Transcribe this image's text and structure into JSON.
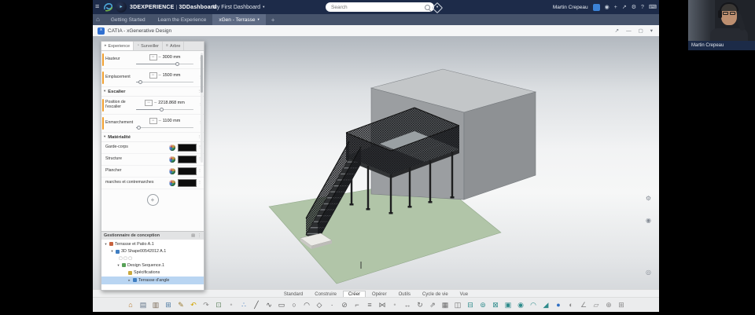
{
  "topbar": {
    "brand": "3DEXPERIENCE",
    "sep": "|",
    "product": "3DDashboard",
    "dashboard": "My First Dashboard",
    "search_placeholder": "Search",
    "user": "Martin Crepeau",
    "accent_color": "#3b82d6",
    "icons": {
      "menu": "≡",
      "compass": "◉",
      "add": "+",
      "share": "↗",
      "settings": "⚙",
      "help": "?",
      "keyboard": "⌨",
      "caret": "▾",
      "play": "▸"
    }
  },
  "tabbar": {
    "tabs": [
      "Getting Started",
      "Learn the Experience"
    ],
    "active": "xGen - Terrasse",
    "caret": "▾",
    "add": "+",
    "home": "⌂"
  },
  "appbar": {
    "title": "CATIA - xGenerative Design",
    "app_initial": "x",
    "icons": {
      "share_user": "↗",
      "minimize": "—",
      "fullscreen": "▢",
      "collapse": "▾"
    }
  },
  "panel": {
    "tabs": [
      {
        "label": "Experience",
        "icon": "▸",
        "bg": "#ffffff"
      },
      {
        "label": "Surveiller",
        "icon": "◔"
      },
      {
        "label": "Arbre",
        "icon": "≡"
      }
    ],
    "dash": "–",
    "kebab": "⋮",
    "caret": "▾",
    "dimension_icon": "▭",
    "accent_color": "#f0a030",
    "params": [
      {
        "label": "Hauteur",
        "value": "3000 mm",
        "fill": "72%",
        "accent": "#f0a030"
      },
      {
        "label": "Emplacement",
        "value": "1500 mm",
        "fill": "8%",
        "accent": "#f0a030"
      }
    ],
    "escalier": {
      "title": "Escalier",
      "params": [
        {
          "label": "Position de l'escalier",
          "value": "2218.868 mm",
          "fill": "45%",
          "accent": "#f0a030"
        },
        {
          "label": "Enmarchement",
          "value": "1100 mm",
          "fill": "6%",
          "accent": "#f0a030"
        }
      ]
    },
    "materialite": {
      "title": "Matérialité",
      "rows": [
        {
          "label": "Garde-corps",
          "swatch": "#0d0d0d"
        },
        {
          "label": "Structure",
          "swatch": "#0d0d0d"
        },
        {
          "label": "Plancher",
          "swatch": "#0d0d0d"
        },
        {
          "label": "marches et contremarches",
          "swatch": "#0d0d0d"
        }
      ]
    },
    "add": "+"
  },
  "design_manager": {
    "title": "Gestionnaire de conception",
    "icons": {
      "list": "▤",
      "kebab": "⋮"
    },
    "chips": "▢ ▢ ▢",
    "tree_top": [
      {
        "label": "Terrasse et Patio A.1",
        "pad": "3px",
        "icon": "#c7623e",
        "expand": "▾"
      },
      {
        "label": "3D Shape00542012 A.1",
        "pad": "11px",
        "icon": "#3f7ec2",
        "expand": "▾"
      }
    ],
    "tree_bottom": [
      {
        "label": "Design Sequence.1",
        "pad": "19px",
        "icon": "#57a157",
        "expand": "▾"
      },
      {
        "label": "Spécifications",
        "pad": "27px",
        "icon": "#caa93f"
      },
      {
        "label": "Terrasse d'angle",
        "pad": "33px",
        "icon": "#3f7ec2",
        "expand": "▸",
        "bg": "#b9d5f2"
      }
    ]
  },
  "viewport": {
    "right_icons": [
      {
        "g": "⚙",
        "n": "settings-icon"
      },
      {
        "g": "◉",
        "n": "assistant-icon"
      },
      {
        "g": "◎",
        "n": "view-cube-icon"
      }
    ]
  },
  "ribbon": {
    "tabs": [
      {
        "label": "Standard"
      },
      {
        "label": "Construire"
      },
      {
        "label": "Créer",
        "bg": "#ffffff",
        "bd": "#c8c9ca",
        "fg": "#222222"
      },
      {
        "label": "Opérer"
      },
      {
        "label": "Outils"
      },
      {
        "label": "Cycle de vie"
      },
      {
        "label": "Vue"
      }
    ]
  },
  "toolbar": {
    "icons": [
      {
        "n": "home-icon",
        "g": "⌂",
        "c": "#b5762a"
      },
      {
        "n": "data-panel-icon",
        "g": "▤",
        "c": "#5f7286"
      },
      {
        "n": "catalog-icon",
        "g": "▥",
        "c": "#7a6a55"
      },
      {
        "n": "window-icon",
        "g": "⊞",
        "c": "#4f7ba3"
      },
      {
        "n": "sketch-icon",
        "g": "✎",
        "c": "#9a7a2f"
      },
      {
        "n": "undo-icon",
        "g": "↶",
        "c": "#d2a400"
      },
      {
        "n": "redo-icon",
        "g": "↷",
        "c": "#8a8a8a"
      },
      {
        "n": "copy-icon",
        "g": "⊡",
        "c": "#6a8a6a"
      },
      {
        "n": "separator-dot",
        "g": "•",
        "c": "#b5b5b5"
      },
      {
        "n": "point-grid-icon",
        "g": "∴",
        "c": "#3a76bd"
      },
      {
        "n": "line-icon",
        "g": "╱",
        "c": "#4a4a4a"
      },
      {
        "n": "spline-icon",
        "g": "∿",
        "c": "#4a4a4a"
      },
      {
        "n": "rectangle-icon",
        "g": "▭",
        "c": "#4a4a4a"
      },
      {
        "n": "circle-icon",
        "g": "○",
        "c": "#4a4a4a"
      },
      {
        "n": "arc-icon",
        "g": "◠",
        "c": "#4a4a4a"
      },
      {
        "n": "polygon-icon",
        "g": "◇",
        "c": "#4a4a4a"
      },
      {
        "n": "point-icon",
        "g": "∙",
        "c": "#4a4a4a"
      },
      {
        "n": "trim-icon",
        "g": "⊘",
        "c": "#6a6a6a"
      },
      {
        "n": "corner-icon",
        "g": "⌐",
        "c": "#6a6a6a"
      },
      {
        "n": "offset-icon",
        "g": "≡",
        "c": "#6a6a6a"
      },
      {
        "n": "mirror-icon",
        "g": "⋈",
        "c": "#6a6a6a"
      },
      {
        "n": "separator-dot",
        "g": "•",
        "c": "#b5b5b5"
      },
      {
        "n": "translate-icon",
        "g": "↔",
        "c": "#6a6a6a"
      },
      {
        "n": "rotate-icon",
        "g": "↻",
        "c": "#6a6a6a"
      },
      {
        "n": "scale-icon",
        "g": "⇗",
        "c": "#6a6a6a"
      },
      {
        "n": "pattern-icon",
        "g": "▦",
        "c": "#6a6a6a"
      },
      {
        "n": "split-icon",
        "g": "◫",
        "c": "#6a6a6a"
      },
      {
        "n": "extrude-icon",
        "g": "⊟",
        "c": "#2e8b8b"
      },
      {
        "n": "revolve-icon",
        "g": "⊚",
        "c": "#2e8b8b"
      },
      {
        "n": "sweep-icon",
        "g": "⊠",
        "c": "#2e8b8b"
      },
      {
        "n": "loft-icon",
        "g": "▣",
        "c": "#2e8b8b"
      },
      {
        "n": "thicken-icon",
        "g": "◉",
        "c": "#2e8b8b"
      },
      {
        "n": "fillet-icon",
        "g": "◠",
        "c": "#2e8b8b"
      },
      {
        "n": "chamfer-icon",
        "g": "◢",
        "c": "#2e8b8b"
      },
      {
        "n": "sphere-icon",
        "g": "●",
        "c": "#2f6fc4"
      },
      {
        "n": "section-icon",
        "g": "◐",
        "c": "#8a8a8a"
      },
      {
        "n": "measure-icon",
        "g": "∠",
        "c": "#8a8a8a"
      },
      {
        "n": "plane-icon",
        "g": "▱",
        "c": "#8a8a8a"
      },
      {
        "n": "anchor-icon",
        "g": "⊕",
        "c": "#8a8a8a"
      },
      {
        "n": "grid-icon",
        "g": "⊞",
        "c": "#8a8a8a"
      }
    ]
  },
  "webcam": {
    "name": "Martin Crepeau"
  }
}
